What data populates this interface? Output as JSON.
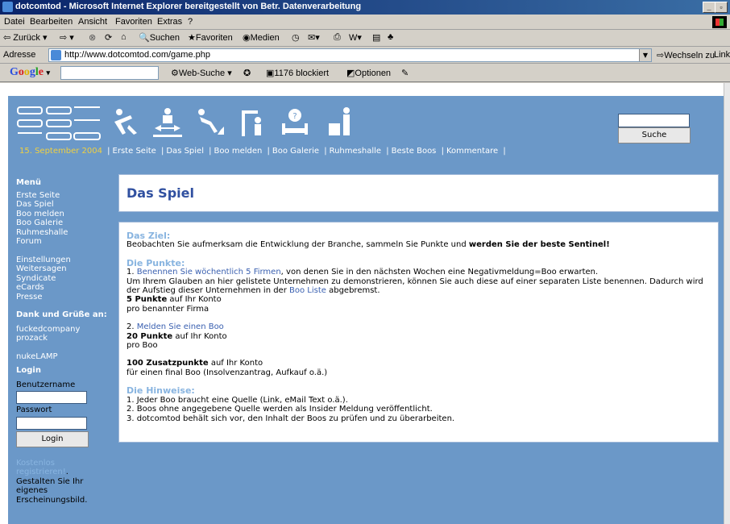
{
  "window": {
    "title": "dotcomtod - Microsoft Internet Explorer bereitgestellt von Betr. Datenverarbeitung"
  },
  "menu": [
    "Datei",
    "Bearbeiten",
    "Ansicht",
    "Favoriten",
    "Extras",
    "?"
  ],
  "toolbar": {
    "back": "Zurück",
    "search": "Suchen",
    "favorites": "Favoriten",
    "media": "Medien"
  },
  "address": {
    "label": "Adresse",
    "url": "http://www.dotcomtod.com/game.php",
    "go": "Wechseln zu",
    "links": "Links"
  },
  "googlebar": {
    "logo": "Google",
    "search": "Web-Suche",
    "blocked": "1176 blockiert",
    "options": "Optionen"
  },
  "header": {
    "date": "15. September 2004",
    "links": [
      "Erste Seite",
      "Das Spiel",
      "Boo melden",
      "Boo Galerie",
      "Ruhmeshalle",
      "Beste Boos",
      "Kommentare"
    ],
    "search_button": "Suche"
  },
  "sidebar": {
    "menu_title": "Menü",
    "menu_items": [
      "Erste Seite",
      "Das Spiel",
      "Boo melden",
      "Boo Galerie",
      "Ruhmeshalle",
      "Forum"
    ],
    "more_items": [
      "Einstellungen",
      "Weitersagen",
      "Syndicate",
      "eCards",
      "Presse"
    ],
    "thanks_title": "Dank und Grüße an:",
    "thanks_items": [
      "fuckedcompany",
      "prozack"
    ],
    "nuke": "nukeLAMP",
    "login_title": "Login",
    "username_label": "Benutzername",
    "password_label": "Passwort",
    "login_button": "Login",
    "register_link": "Kostenlos registrieren!",
    "register_text": ". Gestalten Sie Ihr eigenes Erscheinungsbild."
  },
  "main": {
    "title": "Das Spiel",
    "ziel_title": "Das Ziel:",
    "ziel_text": "Beobachten Sie aufmerksam die Entwicklung der Branche, sammeln Sie Punkte und ",
    "ziel_bold": "werden Sie der beste Sentinel!",
    "punkte_title": "Die Punkte:",
    "p1_num": "1. ",
    "p1_link": "Benennen Sie wöchentlich 5 Firmen",
    "p1_text": ", von denen Sie in den nächsten Wochen eine Negativmeldung=Boo erwarten.",
    "p1_line2": "Um Ihrem Glauben an hier gelistete Unternehmen zu demonstrieren, können Sie auch diese auf einer separaten Liste benennen. Dadurch wird der Aufstieg dieser Unternehmen in der ",
    "p1_list_link": "Boo Liste",
    "p1_line2_end": " abgebremst.",
    "p1_points_bold": "5 Punkte",
    "p1_points_text": " auf Ihr Konto",
    "p1_per": "pro benannter Firma",
    "p2_num": "2. ",
    "p2_link": "Melden Sie einen Boo",
    "p2_points_bold": "20 Punkte",
    "p2_points_text": " auf Ihr Konto",
    "p2_per": "pro Boo",
    "p3_points_bold": "100 Zusatzpunkte",
    "p3_points_text": " auf Ihr Konto",
    "p3_per": "für einen final Boo (Insolvenzantrag, Aufkauf o.ä.)",
    "hinweise_title": "Die Hinweise:",
    "hinweise": [
      "1. Jeder Boo braucht eine Quelle (Link, eMail Text o.ä.).",
      "2. Boos ohne angegebene Quelle werden als Insider Meldung veröffentlicht.",
      "3. dotcomtod behält sich vor, den Inhalt der Boos zu prüfen und zu überarbeiten."
    ]
  }
}
